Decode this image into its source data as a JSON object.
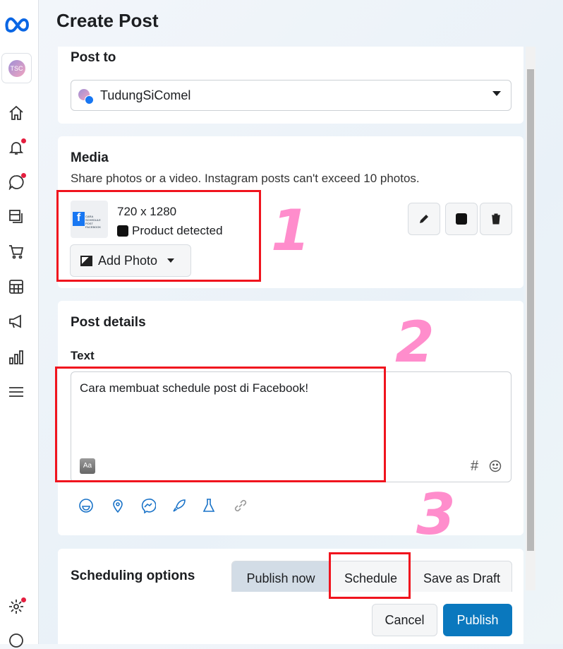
{
  "page_title": "Create Post",
  "post_to": {
    "heading": "Post to",
    "account": "TudungSiComel"
  },
  "media": {
    "heading": "Media",
    "description": "Share photos or a video. Instagram posts can't exceed 10 photos.",
    "dimensions": "720 x 1280",
    "product_status": "Product detected",
    "add_photo": "Add Photo",
    "thumb_text": "CARA SCHEDULE POST FACEBOOK"
  },
  "post_details": {
    "heading": "Post details",
    "text_label": "Text",
    "text_value": "Cara membuat schedule post di Facebook!",
    "hashtag": "#"
  },
  "scheduling": {
    "heading": "Scheduling options",
    "options": [
      "Publish now",
      "Schedule",
      "Save as Draft"
    ],
    "selected": "Publish now"
  },
  "footer": {
    "cancel": "Cancel",
    "publish": "Publish"
  },
  "annotations": [
    "1",
    "2",
    "3"
  ],
  "colors": {
    "accent": "#0a78be",
    "annotation_box": "#f0141e",
    "annotation_text": "#ff7ac4",
    "notification_dot": "#e41e3f"
  }
}
